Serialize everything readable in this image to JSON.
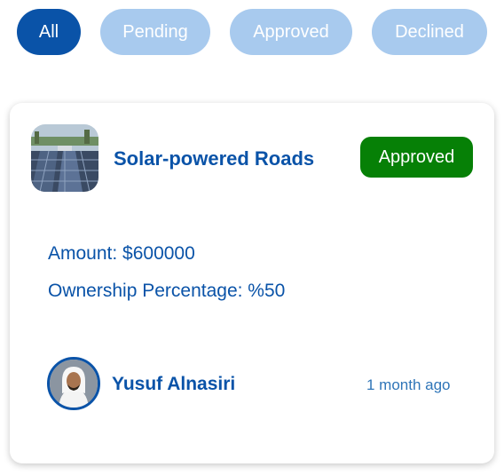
{
  "filters": {
    "all": "All",
    "pending": "Pending",
    "approved": "Approved",
    "declined": "Declined",
    "active": "All"
  },
  "card": {
    "project_title": "Solar-powered Roads",
    "thumbnail_icon": "solar-road-photo",
    "status": "Approved",
    "amount": "Amount: $600000",
    "ownership": "Ownership Percentage: %50",
    "user": {
      "name": "Yusuf Alnasiri",
      "avatar_icon": "user-avatar-photo"
    },
    "timestamp": "1 month ago"
  },
  "colors": {
    "primary": "#0a53a8",
    "pill_inactive": "#a8caee",
    "approved_badge": "#068006",
    "timestamp": "#2f75b8"
  }
}
